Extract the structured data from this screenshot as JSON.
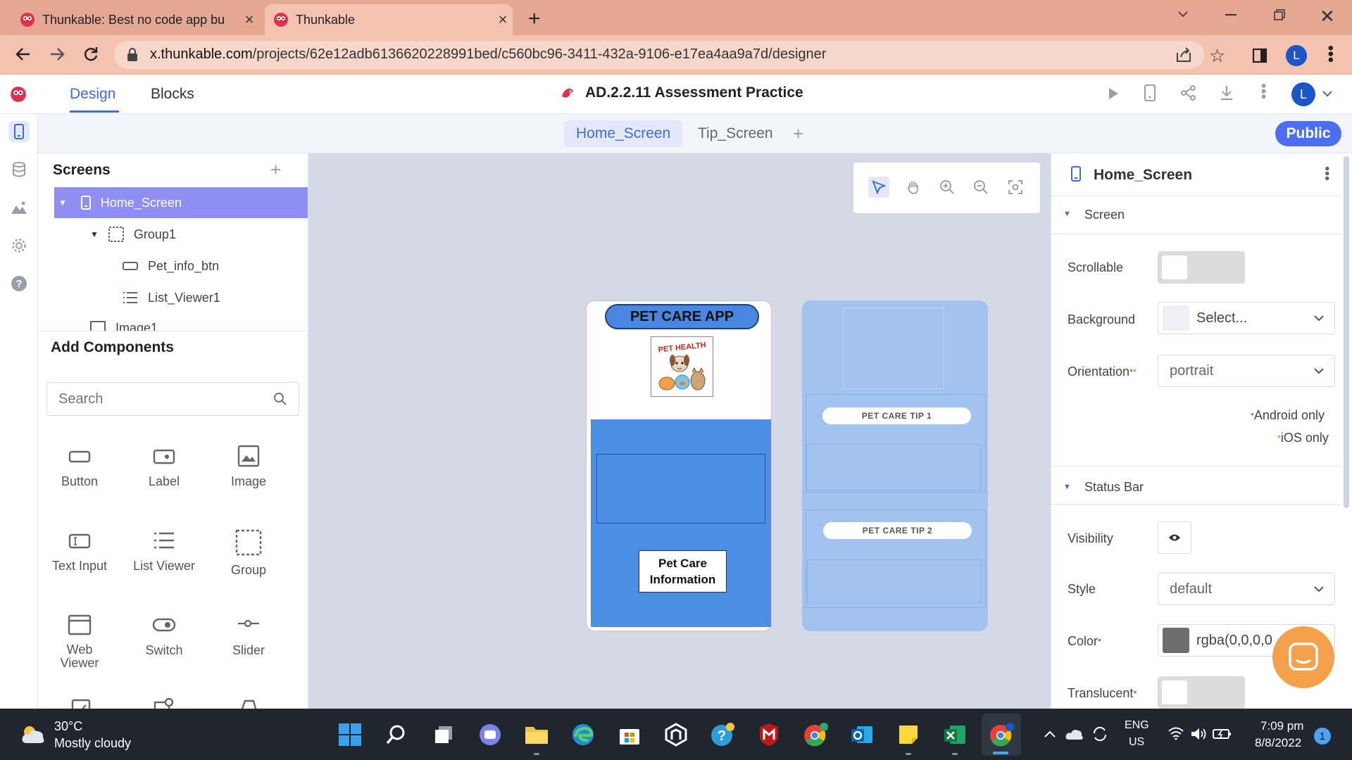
{
  "browser": {
    "tabs": [
      {
        "title": "Thunkable: Best no code app bu",
        "active": false
      },
      {
        "title": "Thunkable",
        "active": true
      }
    ],
    "url_host": "x.thunkable.com",
    "url_path": "/projects/62e12adb6136620228991bed/c560bc96-3411-432a-9106-e17ea4aa9a7d/designer",
    "profile_initial": "L"
  },
  "app_header": {
    "tab_design": "Design",
    "tab_blocks": "Blocks",
    "project_title": "AD.2.2.11 Assessment Practice",
    "profile_initial": "L"
  },
  "screen_tabs": {
    "items": [
      "Home_Screen",
      "Tip_Screen"
    ],
    "active": "Home_Screen",
    "public_label": "Public"
  },
  "screens_panel": {
    "heading": "Screens",
    "tree": [
      {
        "label": "Home_Screen",
        "icon": "phone-icon"
      },
      {
        "label": "Group1",
        "icon": "group-icon"
      },
      {
        "label": "Pet_info_btn",
        "icon": "button-icon"
      },
      {
        "label": "List_Viewer1",
        "icon": "list-icon"
      },
      {
        "label": "Image1",
        "icon": "image-icon"
      }
    ]
  },
  "components_panel": {
    "heading": "Add Components",
    "search_placeholder": "Search",
    "items": [
      "Button",
      "Label",
      "Image",
      "Text Input",
      "List Viewer",
      "Group",
      "Web Viewer",
      "Switch",
      "Slider"
    ]
  },
  "canvas": {
    "phone1": {
      "title": "PET CARE APP",
      "logo_text": "PET HEALTH",
      "button_text": "Pet Care Information"
    },
    "phone2": {
      "tip1": "PET CARE TIP 1",
      "tip2": "PET CARE TIP 2"
    }
  },
  "properties": {
    "screen_name": "Home_Screen",
    "section_screen": "Screen",
    "scrollable_label": "Scrollable",
    "background_label": "Background",
    "background_value": "Select...",
    "orientation_label": "Orientation",
    "orientation_value": "portrait",
    "android_only": "Android only",
    "ios_only": "iOS only",
    "section_status": "Status Bar",
    "visibility_label": "Visibility",
    "style_label": "Style",
    "style_value": "default",
    "color_label": "Color",
    "color_value": "rgba(0,0,0,0",
    "translucent_label": "Translucent"
  },
  "taskbar": {
    "weather_temp": "30°C",
    "weather_desc": "Mostly cloudy",
    "lang_top": "ENG",
    "lang_bottom": "US",
    "time": "7:09 pm",
    "date": "8/8/2022",
    "notification_count": "1"
  },
  "colors": {
    "accent": "#3b6ce0",
    "tabbar": "#e3a792",
    "selected_row": "#8f8ef5",
    "phone_blue": "#4a8fe4",
    "phone2_bg": "#a3c3ef",
    "chat_button": "#f5a04a"
  }
}
